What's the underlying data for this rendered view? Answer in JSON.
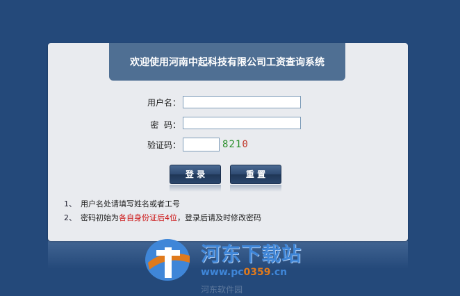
{
  "header": {
    "title": "欢迎使用河南中起科技有限公司工资查询系统"
  },
  "form": {
    "username_label": "用户名：",
    "username_value": "",
    "password_label": "密  码：",
    "password_value": "",
    "captcha_label": "验证码：",
    "captcha_value": "",
    "captcha": [
      {
        "char": "8",
        "color": "#2a8f2a"
      },
      {
        "char": "2",
        "color": "#2a8f2a"
      },
      {
        "char": "1",
        "color": "#2a8f2a"
      },
      {
        "char": "0",
        "color": "#c0392b"
      }
    ]
  },
  "buttons": {
    "login": "登 录",
    "reset": "重 置"
  },
  "notes": [
    {
      "num": "1、",
      "text": "用户名处请填写姓名或者工号",
      "highlight": "",
      "after": ""
    },
    {
      "num": "2、",
      "text": "密码初始为",
      "highlight": "各自身份证后4位",
      "after": "，登录后请及时修改密码"
    }
  ],
  "watermark": {
    "name": "河东下载站",
    "url_prefix": "www.pc",
    "url_number": "0359",
    "url_suffix": ".cn",
    "faded_text": "河东软件园"
  },
  "colors": {
    "background": "#24497a",
    "title_tab": "#4f6f93",
    "highlight_red": "#cc1111"
  }
}
